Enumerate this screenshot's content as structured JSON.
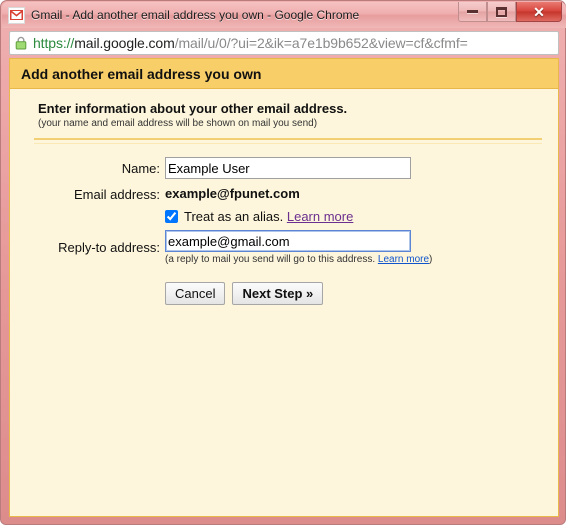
{
  "window": {
    "title": "Gmail - Add another email address you own - Google Chrome",
    "favicon": "gmail-icon",
    "controls": {
      "minimize": "minimize-button",
      "maximize": "restore-button",
      "close": "close-button",
      "close_glyph": "✕"
    }
  },
  "address_bar": {
    "lock_icon": "secure-lock-icon",
    "url_scheme": "https://",
    "url_host": "mail.google.com",
    "url_path": "/mail/u/0/?ui=2&ik=a7e1b9b652&view=cf&cfmf=",
    "full_url": "https://mail.google.com/mail/u/0/?ui=2&ik=a7e1b9b652&view=cf&cfmf="
  },
  "page": {
    "header_title": "Add another email address you own",
    "intro_title": "Enter information about your other email address.",
    "intro_subtitle": "(your name and email address will be shown on mail you send)",
    "form": {
      "name_label": "Name:",
      "name_value": "Example User",
      "email_label": "Email address:",
      "email_value": "example@fpunet.com",
      "alias_label": "Treat as an alias.",
      "alias_checked": true,
      "alias_learn_more": "Learn more",
      "replyto_label": "Reply-to address:",
      "replyto_value": "example@gmail.com",
      "replyto_hint_prefix": "(a reply to mail you send will go to this address. ",
      "replyto_learn_more": "Learn more",
      "replyto_hint_suffix": ")"
    },
    "buttons": {
      "cancel": "Cancel",
      "next": "Next Step »"
    }
  },
  "colors": {
    "header_bg": "#f7ce68",
    "page_bg": "#fdf6dc",
    "page_border": "#e8b84b",
    "frame": "#e79a9a",
    "link": "#1155cc",
    "visited_link": "#6b2f8f",
    "lock_green": "#8fd16a",
    "focus_border": "#5c85d6"
  }
}
